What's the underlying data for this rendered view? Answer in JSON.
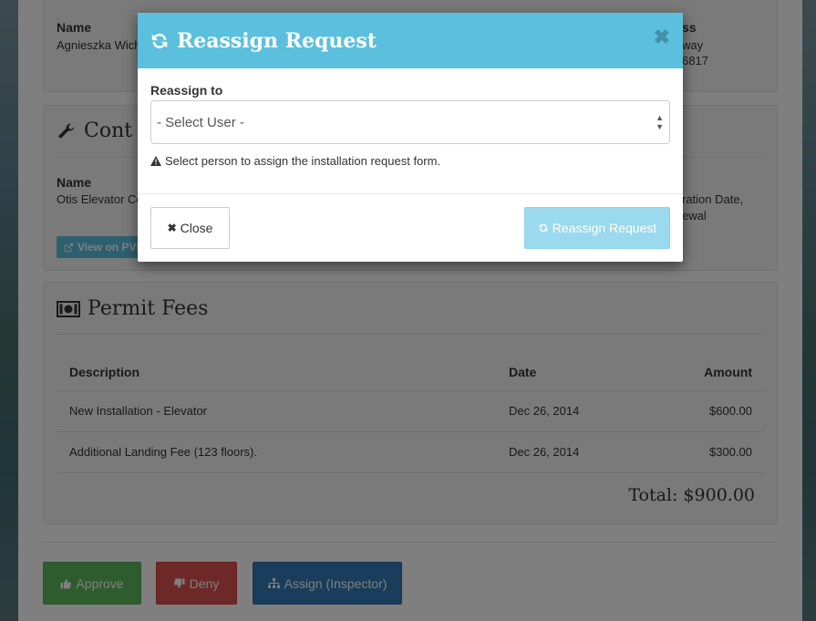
{
  "background": {
    "owner": {
      "name_label": "Name",
      "name_value": "Agnieszka Wich",
      "address_label": "ss",
      "address_line1": "way",
      "address_line2": "6817"
    },
    "contractor": {
      "title": "Cont",
      "name_label": "Name",
      "name_value": "Otis Elevator Co",
      "exp_line1": "ration Date,",
      "exp_line2": "ewal",
      "pvl_button": "View on PVL"
    },
    "fees": {
      "title": "Permit Fees",
      "columns": [
        "Description",
        "Date",
        "Amount"
      ],
      "rows": [
        {
          "description": "New Installation - Elevator",
          "date": "Dec 26, 2014",
          "amount": "$600.00"
        },
        {
          "description": "Additional Landing Fee (123 floors).",
          "date": "Dec 26, 2014",
          "amount": "$300.00"
        }
      ],
      "total": "Total: $900.00"
    },
    "actions": {
      "approve": "Approve",
      "deny": "Deny",
      "assign": "Assign (Inspector)"
    }
  },
  "modal": {
    "title": "Reassign Request",
    "field_label": "Reassign to",
    "select_value": "- Select User -",
    "help_text": "Select person to assign the installation request form.",
    "close_label": "Close",
    "submit_label": "Reassign Request"
  },
  "colors": {
    "info": "#5bc0de",
    "success": "#5cb85c",
    "danger": "#d9534f",
    "primary": "#337ab7"
  }
}
